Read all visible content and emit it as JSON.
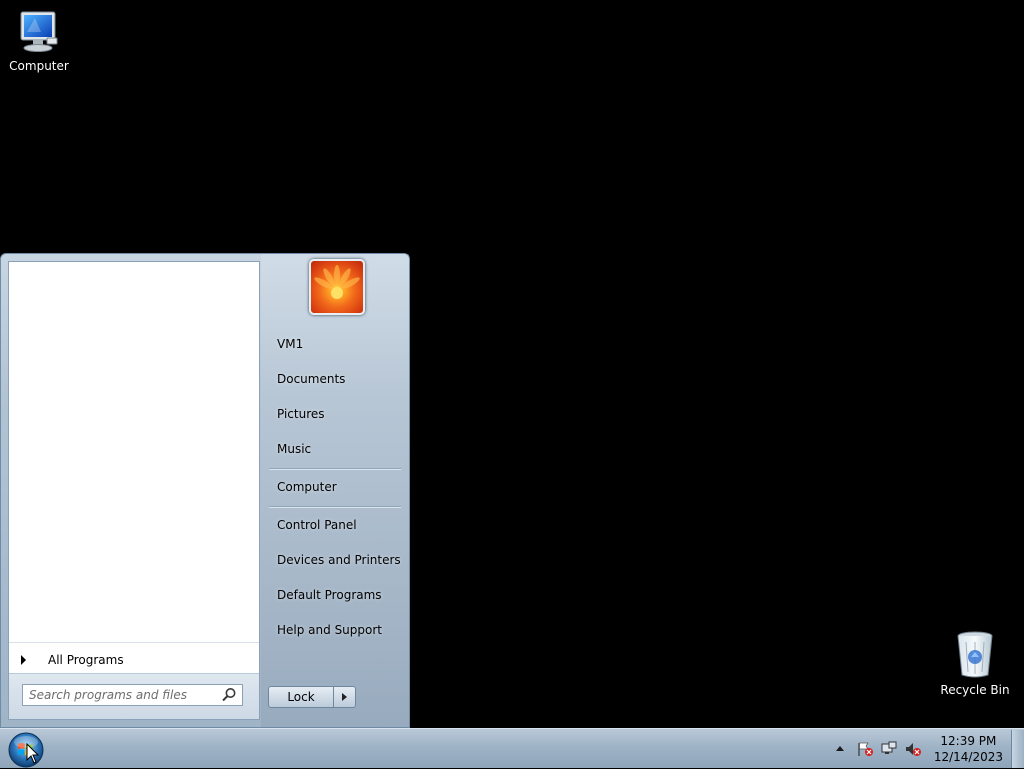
{
  "desktop": {
    "icons": [
      {
        "label": "Computer"
      },
      {
        "label": "Recycle Bin"
      }
    ]
  },
  "start_menu": {
    "all_programs_label": "All Programs",
    "search_placeholder": "Search programs and files",
    "right_items": [
      "VM1",
      "Documents",
      "Pictures",
      "Music",
      "Computer",
      "Control Panel",
      "Devices and Printers",
      "Default Programs",
      "Help and Support"
    ],
    "lock_label": "Lock"
  },
  "taskbar": {
    "clock_time": "12:39 PM",
    "clock_date": "12/14/2023"
  },
  "colors": {
    "desktop_background": "#000000",
    "taskbar": "#9fb3c6",
    "start_menu_frame": "#b2c3d4"
  }
}
